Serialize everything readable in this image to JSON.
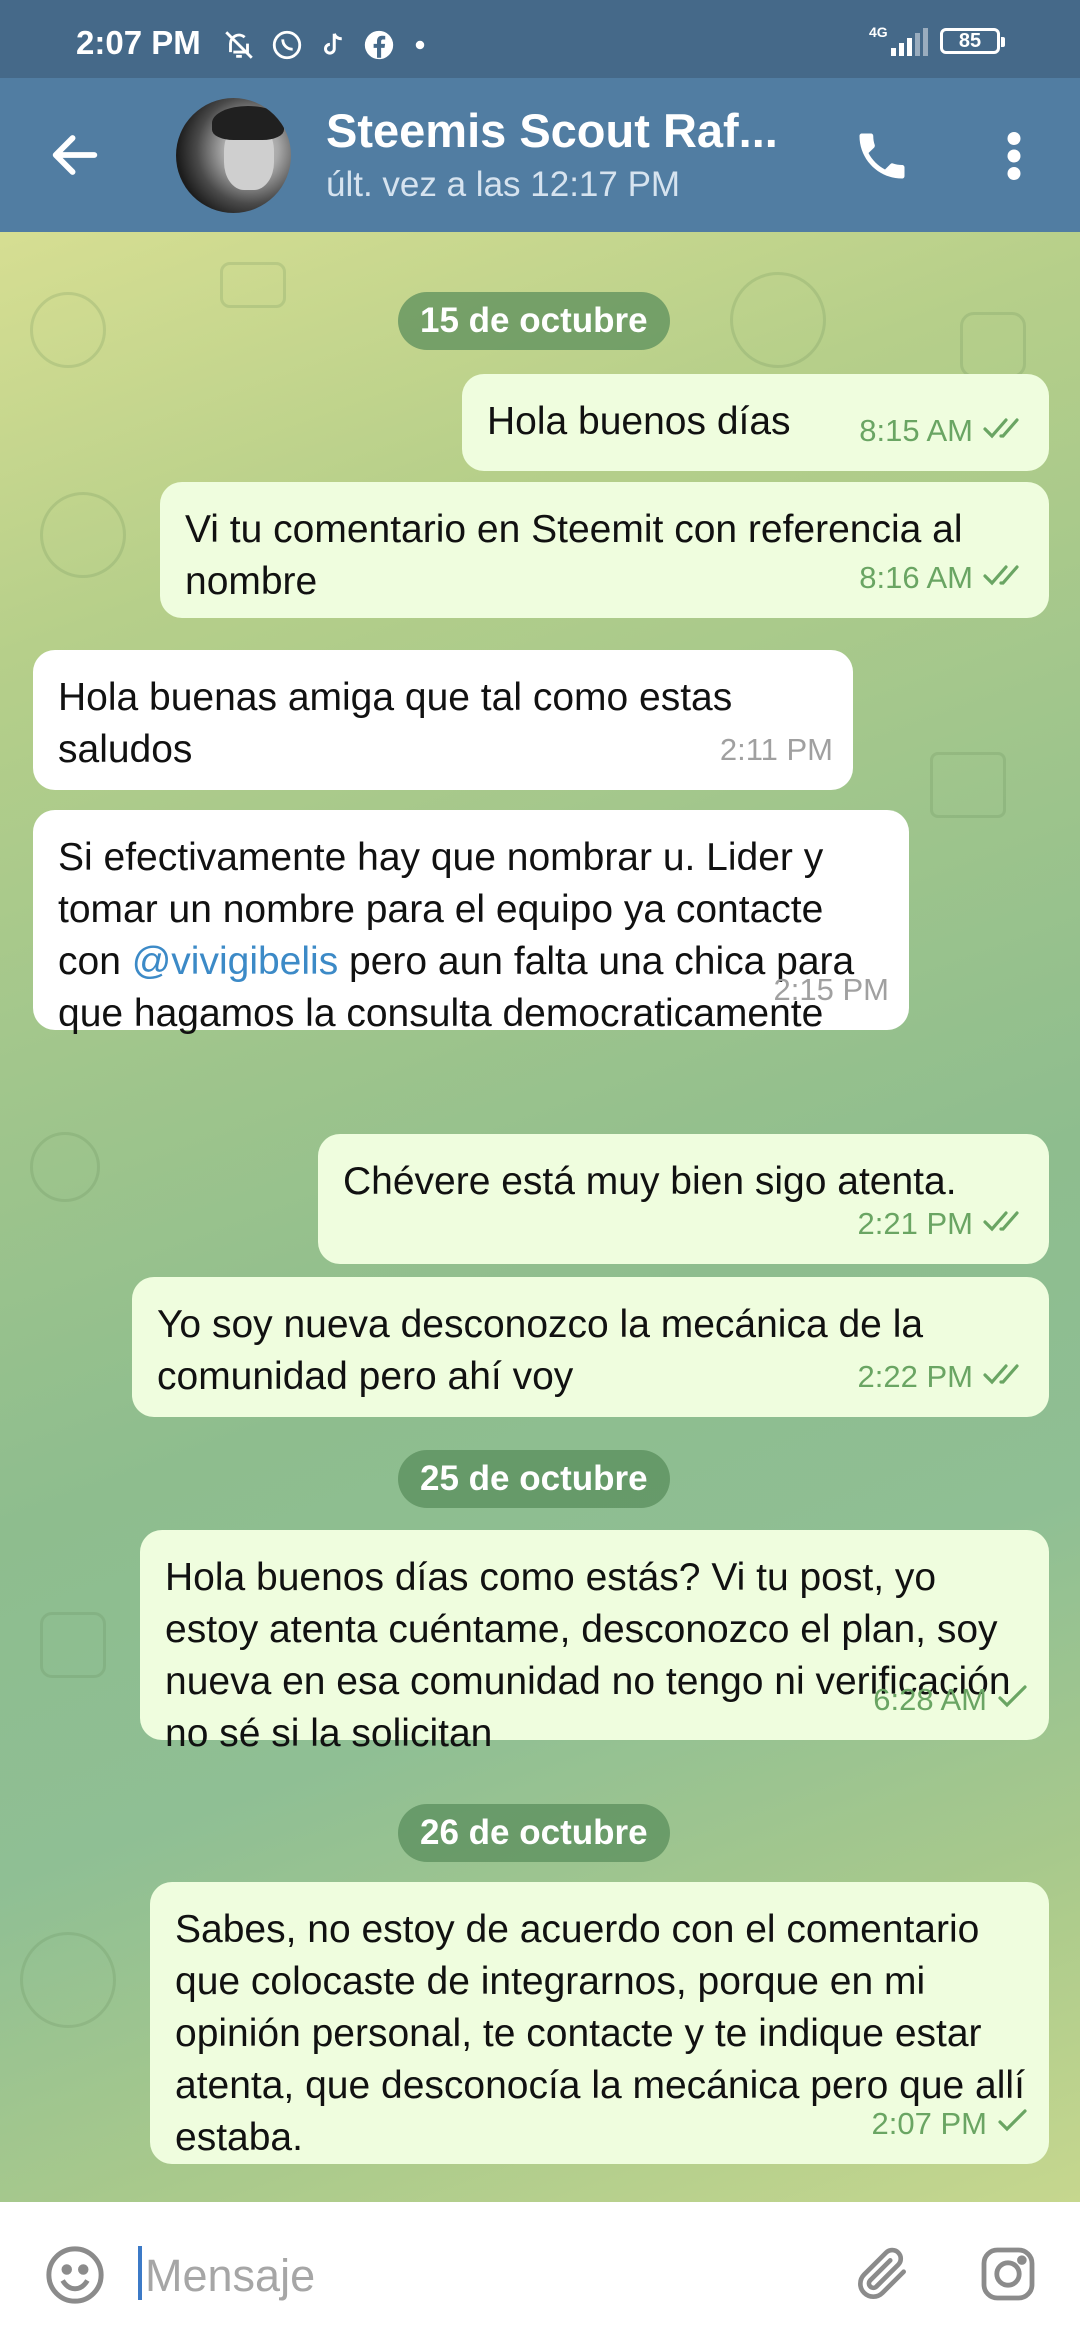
{
  "status_bar": {
    "time": "2:07 PM",
    "network": "4G",
    "battery": "85",
    "icons": [
      "muted-bell-icon",
      "whatsapp-icon",
      "tiktok-icon",
      "facebook-icon",
      "dot-icon",
      "signal-icon",
      "battery-icon"
    ]
  },
  "header": {
    "contact_name": "Steemis Scout Raf...",
    "last_seen": "últ. vez a las 12:17 PM",
    "icons": [
      "back-arrow-icon",
      "avatar",
      "phone-icon",
      "more-vertical-icon"
    ]
  },
  "chat": {
    "date_chips": [
      "15 de octubre",
      "25 de octubre",
      "26 de octubre"
    ],
    "messages": [
      {
        "direction": "out",
        "text": "Hola buenos días",
        "time": "8:15 AM",
        "status": "read"
      },
      {
        "direction": "out",
        "text": "Vi tu comentario en Steemit con referencia al nombre",
        "time": "8:16 AM",
        "status": "read"
      },
      {
        "direction": "in",
        "text": "Hola buenas amiga que tal como estas saludos",
        "time": "2:11 PM"
      },
      {
        "direction": "in",
        "text_before": "Si efectivamente hay que nombrar u. Lider y tomar un nombre para el equipo ya contacte con ",
        "mention": "@vivigibelis",
        "text_after": " pero aun falta una chica para que hagamos la consulta democraticamente",
        "time": "2:15 PM"
      },
      {
        "direction": "out",
        "text": "Chévere está muy bien sigo atenta.",
        "time": "2:21 PM",
        "status": "read"
      },
      {
        "direction": "out",
        "text": "Yo soy nueva desconozco la mecánica de la comunidad pero ahí voy",
        "time": "2:22 PM",
        "status": "read"
      },
      {
        "direction": "out",
        "text": "Hola buenos días como estás? Vi tu post, yo estoy atenta cuéntame, desconozco el plan, soy nueva en esa comunidad no tengo ni verificación no sé si la solicitan",
        "time": "6:28 AM",
        "status": "sent"
      },
      {
        "direction": "out",
        "text": "Sabes, no estoy de acuerdo con el comentario que colocaste de integrarnos, porque en mi opinión personal, te contacte y te indique estar atenta, que desconocía la mecánica pero que allí estaba.",
        "time": "2:07 PM",
        "status": "sent"
      }
    ]
  },
  "composer": {
    "placeholder": "Mensaje",
    "icons": [
      "emoji-icon",
      "attach-icon",
      "camera-icon"
    ]
  },
  "colors": {
    "header": "#517da2",
    "status_bar": "#456989",
    "outgoing_bubble": "#effdde",
    "incoming_bubble": "#ffffff",
    "check": "#6aa563",
    "mention": "#3c8ac7"
  }
}
